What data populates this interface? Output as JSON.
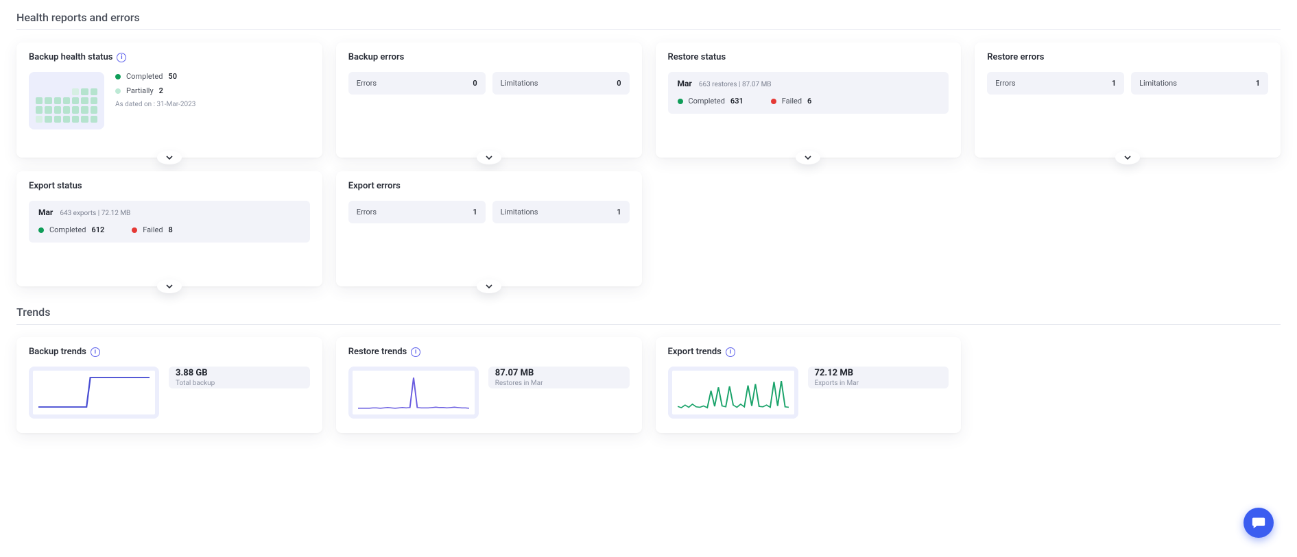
{
  "sections": {
    "health_title": "Health reports and errors",
    "trends_title": "Trends"
  },
  "backup_health": {
    "title": "Backup health status",
    "completed_label": "Completed",
    "completed_count": "50",
    "partially_label": "Partially",
    "partially_count": "2",
    "as_dated": "As dated on : 31-Mar-2023"
  },
  "backup_errors": {
    "title": "Backup errors",
    "errors_label": "Errors",
    "errors_value": "0",
    "limitations_label": "Limitations",
    "limitations_value": "0"
  },
  "restore_status": {
    "title": "Restore status",
    "month": "Mar",
    "summary": "663 restores | 87.07 MB",
    "completed_label": "Completed",
    "completed_value": "631",
    "failed_label": "Failed",
    "failed_value": "6"
  },
  "restore_errors": {
    "title": "Restore errors",
    "errors_label": "Errors",
    "errors_value": "1",
    "limitations_label": "Limitations",
    "limitations_value": "1"
  },
  "export_status": {
    "title": "Export status",
    "month": "Mar",
    "summary": "643 exports | 72.12 MB",
    "completed_label": "Completed",
    "completed_value": "612",
    "failed_label": "Failed",
    "failed_value": "8"
  },
  "export_errors": {
    "title": "Export errors",
    "errors_label": "Errors",
    "errors_value": "1",
    "limitations_label": "Limitations",
    "limitations_value": "1"
  },
  "backup_trends": {
    "title": "Backup trends",
    "value": "3.88 GB",
    "caption": "Total backup"
  },
  "restore_trends": {
    "title": "Restore trends",
    "value": "87.07 MB",
    "caption": "Restores in Mar"
  },
  "export_trends": {
    "title": "Export trends",
    "value": "72.12 MB",
    "caption": "Exports in Mar"
  },
  "chart_data": [
    {
      "type": "line",
      "id": "backup-trend-spark",
      "title": "Backup trends",
      "ylabel": "Total backup (GB)",
      "x": [
        0,
        1,
        2,
        3,
        4,
        5,
        6,
        7,
        8,
        9,
        10,
        11,
        12,
        13,
        14,
        15,
        16,
        17,
        18,
        19,
        20,
        21,
        22,
        23,
        24,
        25,
        26,
        27,
        28,
        29,
        30
      ],
      "values": [
        0.2,
        0.2,
        0.2,
        0.2,
        0.2,
        0.2,
        0.2,
        0.2,
        0.2,
        0.2,
        0.2,
        0.2,
        0.2,
        0.2,
        3.88,
        3.88,
        3.88,
        3.88,
        3.88,
        3.88,
        3.88,
        3.88,
        3.88,
        3.88,
        3.88,
        3.88,
        3.88,
        3.88,
        3.88,
        3.88,
        3.88
      ],
      "ylim": [
        0,
        4
      ]
    },
    {
      "type": "line",
      "id": "restore-trend-spark",
      "title": "Restore trends",
      "ylabel": "Restores (MB)",
      "x": [
        0,
        1,
        2,
        3,
        4,
        5,
        6,
        7,
        8,
        9,
        10,
        11,
        12,
        13,
        14,
        15,
        16,
        17,
        18,
        19,
        20,
        21,
        22,
        23,
        24,
        25,
        26,
        27,
        28,
        29,
        30
      ],
      "values": [
        1,
        1,
        1,
        1,
        2,
        2,
        1,
        2,
        3,
        2,
        1,
        2,
        3,
        2,
        3,
        87,
        3,
        2,
        2,
        2,
        3,
        4,
        3,
        3,
        2,
        3,
        4,
        3,
        2,
        2,
        1
      ],
      "ylim": [
        0,
        90
      ]
    },
    {
      "type": "line",
      "id": "export-trend-spark",
      "title": "Export trends",
      "ylabel": "Exports (MB)",
      "x": [
        0,
        1,
        2,
        3,
        4,
        5,
        6,
        7,
        8,
        9,
        10,
        11,
        12,
        13,
        14,
        15,
        16,
        17,
        18,
        19,
        20,
        21,
        22,
        23,
        24,
        25,
        26,
        27,
        28,
        29,
        30
      ],
      "values": [
        5,
        2,
        8,
        3,
        10,
        4,
        3,
        6,
        2,
        40,
        5,
        48,
        6,
        4,
        50,
        8,
        3,
        10,
        4,
        52,
        6,
        55,
        5,
        4,
        8,
        3,
        60,
        6,
        62,
        4,
        3
      ],
      "ylim": [
        0,
        72
      ]
    }
  ]
}
